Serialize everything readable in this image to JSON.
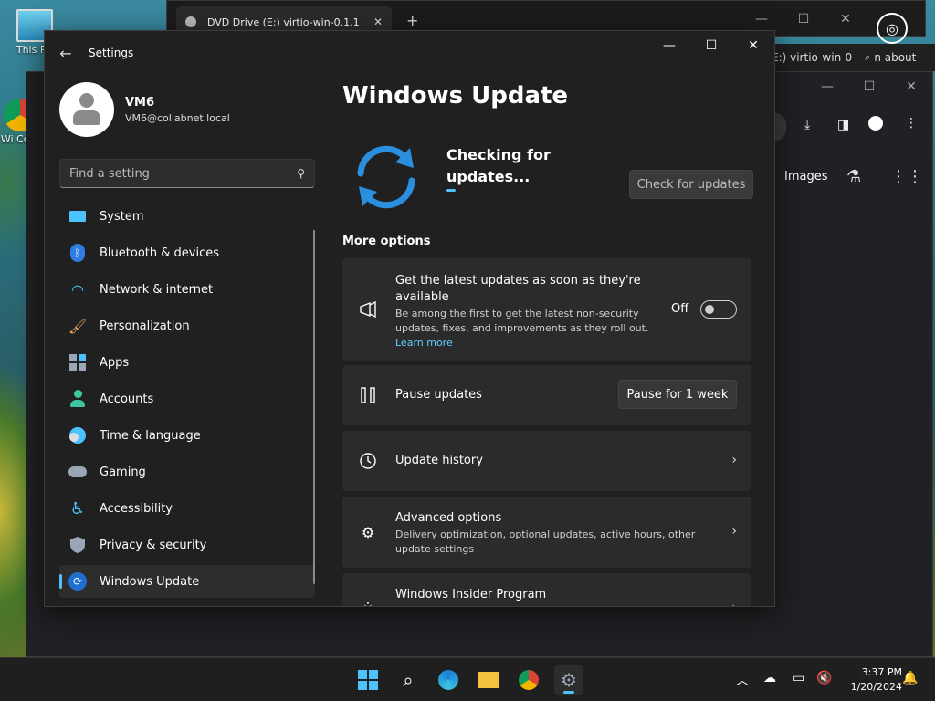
{
  "desktop": {
    "icons": [
      {
        "label": "This PC"
      },
      {
        "label": "Wi Com"
      }
    ]
  },
  "background_windows": {
    "explorer": {
      "tab_title": "DVD Drive (E:) virtio-win-0.1.1",
      "partial_title": "E:) virtio-win-0",
      "partial_about": "n about"
    },
    "browser": {
      "images_label": "Images"
    }
  },
  "settings": {
    "window_title": "Settings",
    "profile": {
      "name": "VM6",
      "email": "VM6@collabnet.local"
    },
    "search": {
      "placeholder": "Find a setting"
    },
    "nav": [
      {
        "label": "System",
        "icon": "system-icon",
        "color": "#4cc2ff"
      },
      {
        "label": "Bluetooth & devices",
        "icon": "bluetooth-icon",
        "color": "#2f7de1"
      },
      {
        "label": "Network & internet",
        "icon": "wifi-icon",
        "color": "#4cc2ff"
      },
      {
        "label": "Personalization",
        "icon": "brush-icon",
        "color": "#e8a55c"
      },
      {
        "label": "Apps",
        "icon": "apps-icon",
        "color": "#9aa6b8"
      },
      {
        "label": "Accounts",
        "icon": "accounts-icon",
        "color": "#3dc6a0"
      },
      {
        "label": "Time & language",
        "icon": "clock-globe-icon",
        "color": "#4cc2ff"
      },
      {
        "label": "Gaming",
        "icon": "gamepad-icon",
        "color": "#9aa6b8"
      },
      {
        "label": "Accessibility",
        "icon": "accessibility-icon",
        "color": "#4cc2ff"
      },
      {
        "label": "Privacy & security",
        "icon": "shield-icon",
        "color": "#9aa6b8"
      },
      {
        "label": "Windows Update",
        "icon": "windows-update-icon",
        "color": "#4cc2ff",
        "active": true
      }
    ],
    "page_title": "Windows Update",
    "status": {
      "text": "Checking for updates...",
      "check_button": "Check for updates"
    },
    "more_options_heading": "More options",
    "cards": {
      "latest": {
        "title": "Get the latest updates as soon as they're available",
        "desc": "Be among the first to get the latest non-security updates, fixes, and improvements as they roll out.",
        "link": "Learn more",
        "toggle_label": "Off",
        "toggle_on": false
      },
      "pause": {
        "title": "Pause updates",
        "button": "Pause for 1 week"
      },
      "history": {
        "title": "Update history"
      },
      "advanced": {
        "title": "Advanced options",
        "desc": "Delivery optimization, optional updates, active hours, other update settings"
      },
      "insider": {
        "title": "Windows Insider Program"
      }
    }
  },
  "taskbar": {
    "time": "3:37 PM",
    "date": "1/20/2024",
    "accent": "#4cc2ff"
  }
}
